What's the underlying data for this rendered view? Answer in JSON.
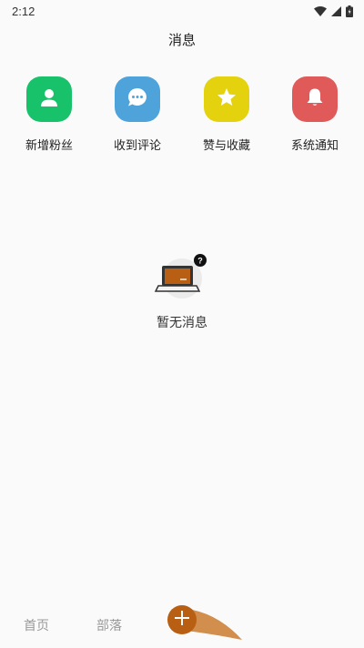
{
  "status_bar": {
    "time": "2:12",
    "icons": [
      "wifi-icon",
      "signal-icon",
      "battery-icon"
    ]
  },
  "page": {
    "title": "消息"
  },
  "shortcuts": [
    {
      "label": "新增粉丝",
      "icon": "person-icon",
      "color": "#17c26a"
    },
    {
      "label": "收到评论",
      "icon": "comment-icon",
      "color": "#4fa3db"
    },
    {
      "label": "赞与收藏",
      "icon": "star-icon",
      "color": "#e5d20f"
    },
    {
      "label": "系统通知",
      "icon": "bell-icon",
      "color": "#e05a5a"
    }
  ],
  "empty_state": {
    "icon": "laptop-question-icon",
    "text": "暂无消息"
  },
  "bottom_nav": {
    "home_label": "首页",
    "tribe_label": "部落",
    "add_icon": "plus-icon",
    "accent_color": "#b85f14"
  }
}
